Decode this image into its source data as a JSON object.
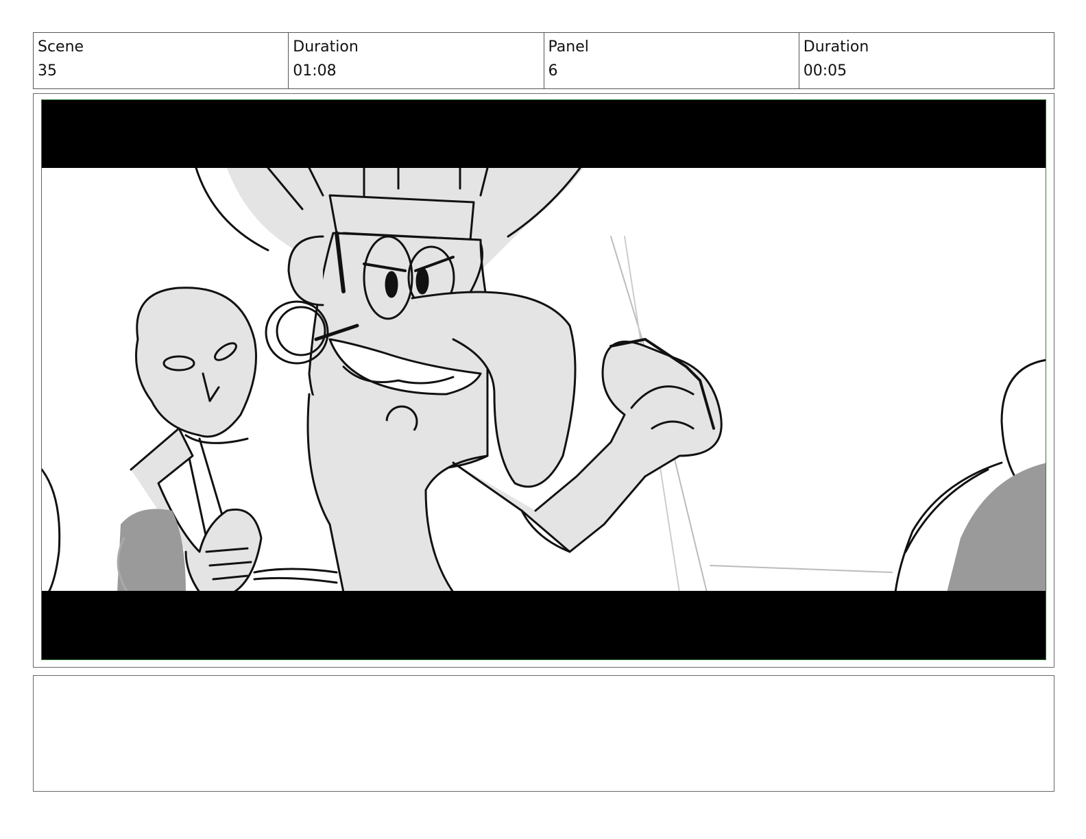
{
  "header": {
    "scene_label": "Scene",
    "scene_value": "35",
    "scene_duration_label": "Duration",
    "scene_duration_value": "01:08",
    "panel_label": "Panel",
    "panel_value": "6",
    "panel_duration_label": "Duration",
    "panel_duration_value": "00:05"
  },
  "notes": {
    "text": ""
  }
}
